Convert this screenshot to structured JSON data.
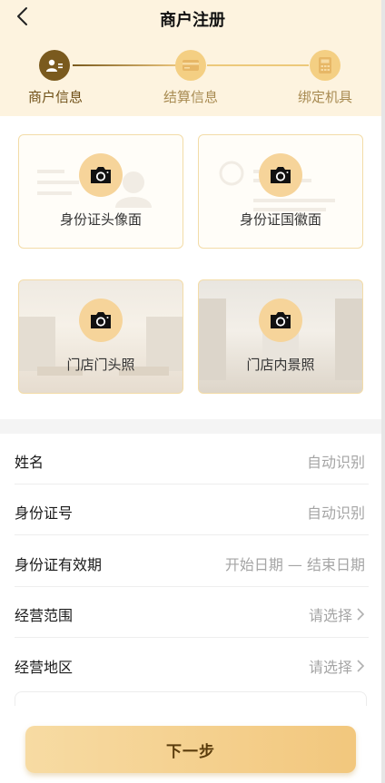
{
  "header": {
    "title": "商户注册"
  },
  "steps": [
    {
      "label": "商户信息",
      "icon": "merchant-id-icon"
    },
    {
      "label": "结算信息",
      "icon": "card-icon"
    },
    {
      "label": "绑定机具",
      "icon": "pos-terminal-icon"
    }
  ],
  "uploads": [
    {
      "label": "身份证头像面",
      "icon": "camera-icon"
    },
    {
      "label": "身份证国徽面",
      "icon": "camera-icon"
    },
    {
      "label": "门店门头照",
      "icon": "camera-icon"
    },
    {
      "label": "门店内景照",
      "icon": "camera-icon"
    }
  ],
  "form": {
    "name": {
      "label": "姓名",
      "value": "自动识别"
    },
    "id_number": {
      "label": "身份证号",
      "value": "自动识别"
    },
    "id_validity": {
      "label": "身份证有效期",
      "value": "开始日期 — 结束日期"
    },
    "business_scope": {
      "label": "经营范围",
      "value": "请选择"
    },
    "business_region": {
      "label": "经营地区",
      "value": "请选择"
    }
  },
  "actions": {
    "next_label": "下一步"
  },
  "colors": {
    "accent_dark": "#7a5a1e",
    "accent_light": "#f4cf83",
    "header_bg": "#fdf3df"
  }
}
